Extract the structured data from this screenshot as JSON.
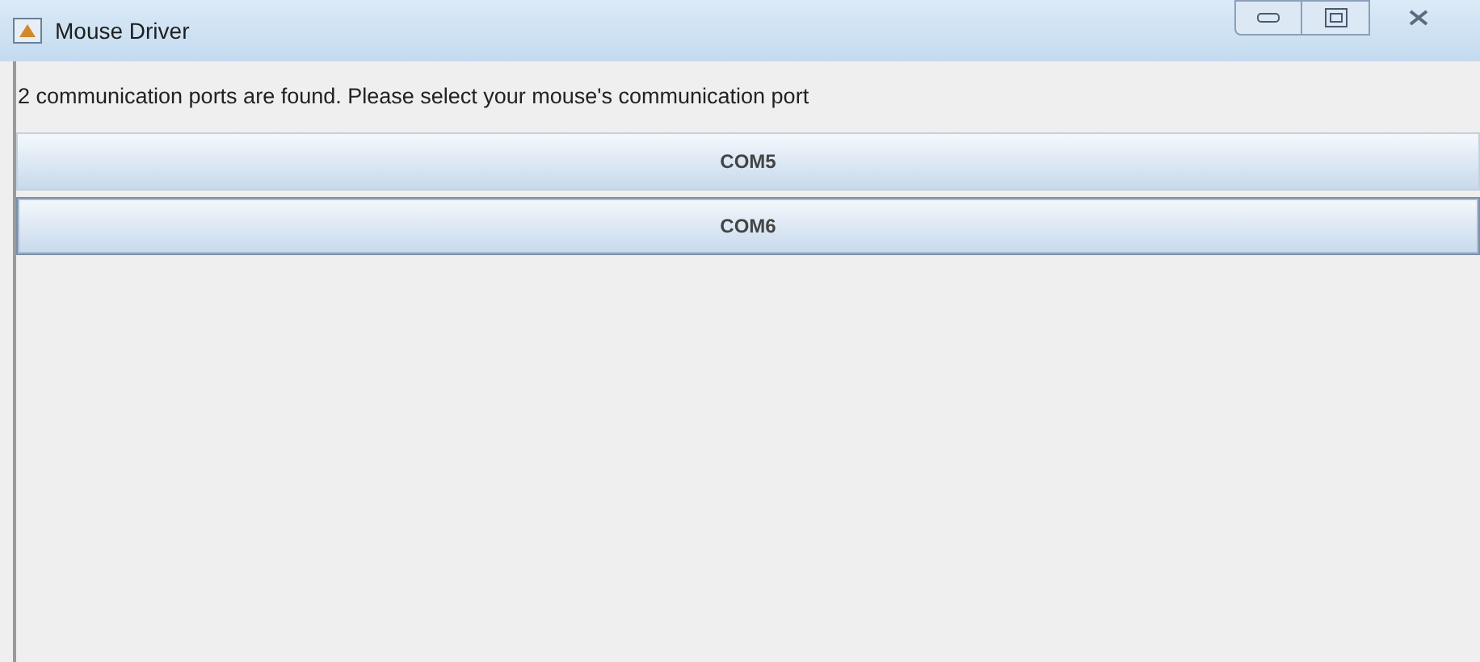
{
  "window": {
    "title": "Mouse Driver"
  },
  "message": "2 communication ports are found. Please select your mouse's communication port",
  "ports": [
    {
      "label": "COM5",
      "selected": false
    },
    {
      "label": "COM6",
      "selected": true
    }
  ]
}
